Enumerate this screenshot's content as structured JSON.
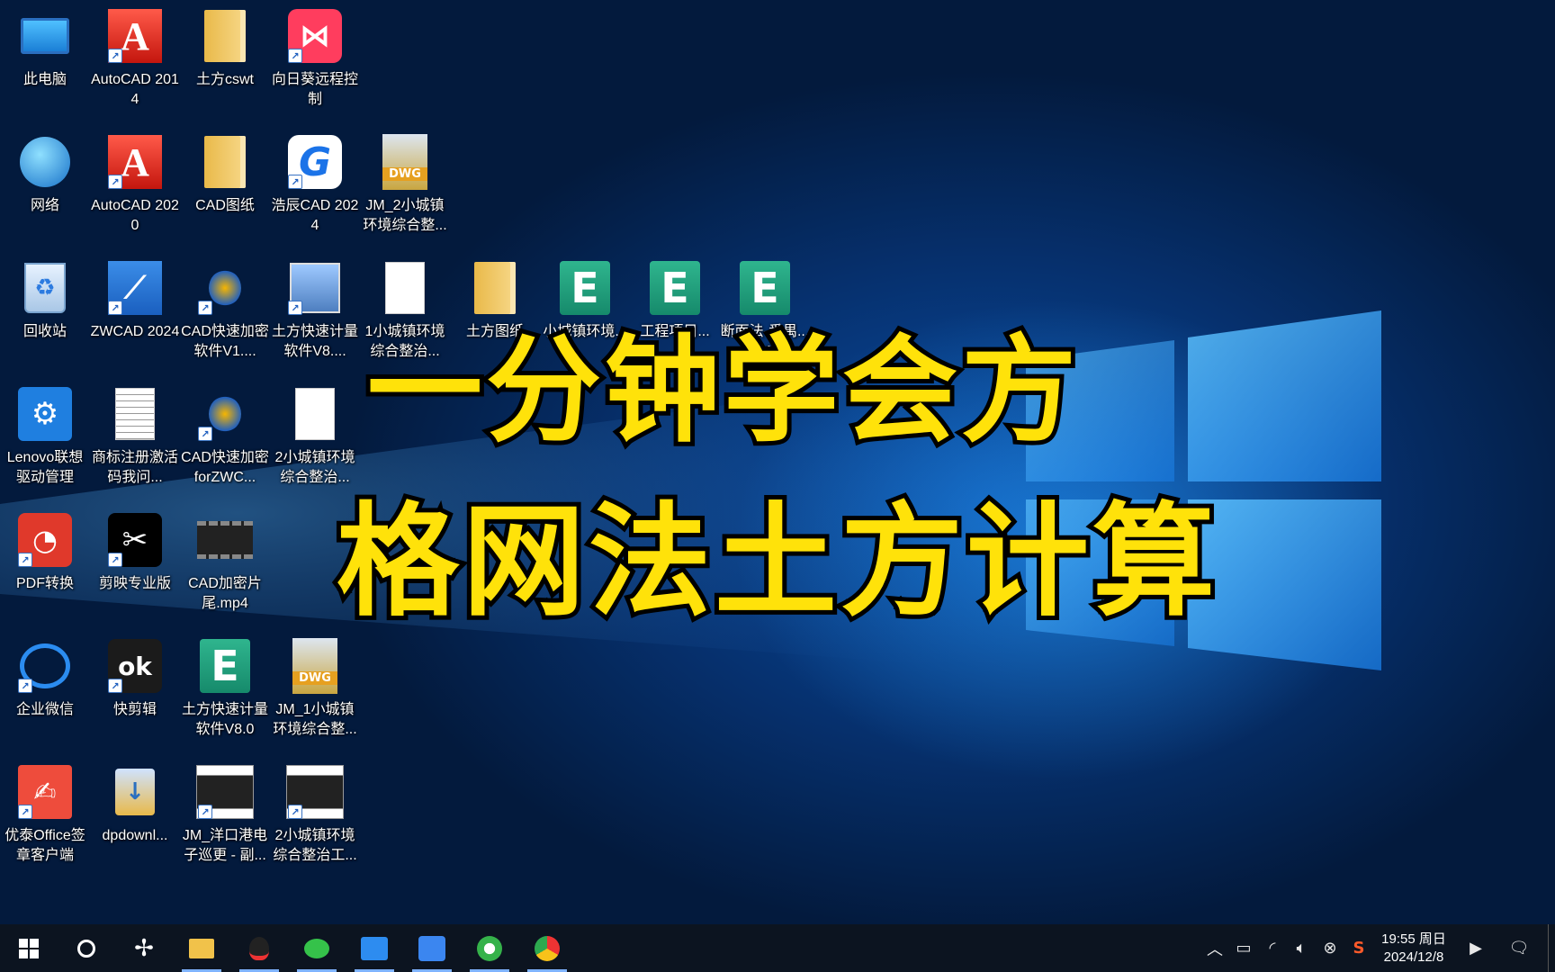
{
  "overlay": {
    "line1": "一分钟学会方",
    "line2": "格网法土方计算"
  },
  "desktop_icons": [
    {
      "label": "此电脑",
      "icon": "computer-icon"
    },
    {
      "label": "AutoCAD 2014",
      "icon": "autocad-icon"
    },
    {
      "label": "土方cswt",
      "icon": "folder-icon"
    },
    {
      "label": "向日葵远程控制",
      "icon": "sunlogin-icon"
    },
    {
      "label": "网络",
      "icon": "network-icon"
    },
    {
      "label": "AutoCAD 2020",
      "icon": "autocad-icon"
    },
    {
      "label": "CAD图纸",
      "icon": "folder-icon"
    },
    {
      "label": "浩辰CAD 2024",
      "icon": "gstarcad-icon"
    },
    {
      "label": "JM_2小城镇环境综合整...",
      "icon": "dwg-file-icon"
    },
    {
      "label": "回收站",
      "icon": "recycle-bin-icon"
    },
    {
      "label": "ZWCAD 2024",
      "icon": "zwcad-icon"
    },
    {
      "label": "CAD快速加密软件V1....",
      "icon": "app-shortcut-icon"
    },
    {
      "label": "土方快速计量软件V8....",
      "icon": "installer-icon"
    },
    {
      "label": "1小城镇环境综合整治...",
      "icon": "document-icon"
    },
    {
      "label": "土方图纸",
      "icon": "folder-icon"
    },
    {
      "label": "小城镇环境...",
      "icon": "e-file-icon"
    },
    {
      "label": "工程项目...",
      "icon": "e-file-icon"
    },
    {
      "label": "断面法-番禺...24.1...",
      "icon": "e-file-icon"
    },
    {
      "label": "Lenovo联想驱动管理",
      "icon": "lenovo-icon"
    },
    {
      "label": "商标注册激活码我问...",
      "icon": "text-file-icon"
    },
    {
      "label": "CAD快速加密forZWC...",
      "icon": "app-shortcut-icon"
    },
    {
      "label": "2小城镇环境综合整治...",
      "icon": "document-icon"
    },
    {
      "label": "PDF转换",
      "icon": "pdf-icon"
    },
    {
      "label": "剪映专业版",
      "icon": "capcut-icon"
    },
    {
      "label": "CAD加密片尾.mp4",
      "icon": "video-icon"
    },
    {
      "label": "企业微信",
      "icon": "wecom-icon"
    },
    {
      "label": "快剪辑",
      "icon": "kuaijianji-icon"
    },
    {
      "label": "土方快速计量软件V8.0",
      "icon": "e-file-icon"
    },
    {
      "label": "JM_1小城镇环境综合整...",
      "icon": "dwg-file-icon"
    },
    {
      "label": "优泰Office签章客户端",
      "icon": "signature-icon"
    },
    {
      "label": "dpdownl...",
      "icon": "download-icon"
    },
    {
      "label": "JM_洋口港电子巡更 - 副...",
      "icon": "image-file-icon"
    },
    {
      "label": "2小城镇环境综合整治工...",
      "icon": "image-file-icon"
    }
  ],
  "taskbar": {
    "apps": [
      {
        "name": "start-button",
        "icon": "windows-icon"
      },
      {
        "name": "cortana-button",
        "icon": "search-circle-icon"
      },
      {
        "name": "taskbar-app-fan",
        "icon": "fan-icon"
      },
      {
        "name": "taskbar-app-explorer",
        "icon": "folder-icon"
      },
      {
        "name": "taskbar-app-qq",
        "icon": "qq-icon"
      },
      {
        "name": "taskbar-app-wechat",
        "icon": "wechat-icon"
      },
      {
        "name": "taskbar-app-photos",
        "icon": "photos-icon"
      },
      {
        "name": "taskbar-app-feishu",
        "icon": "bird-icon"
      },
      {
        "name": "taskbar-app-360",
        "icon": "browser-360-icon"
      },
      {
        "name": "taskbar-app-chrome",
        "icon": "chrome-icon"
      }
    ],
    "clock": {
      "time": "19:55 周日",
      "date": "2024/12/8"
    }
  },
  "colors": {
    "title_fill": "#ffe20a",
    "title_stroke": "#000000",
    "taskbar_bg": "#0c1420"
  }
}
